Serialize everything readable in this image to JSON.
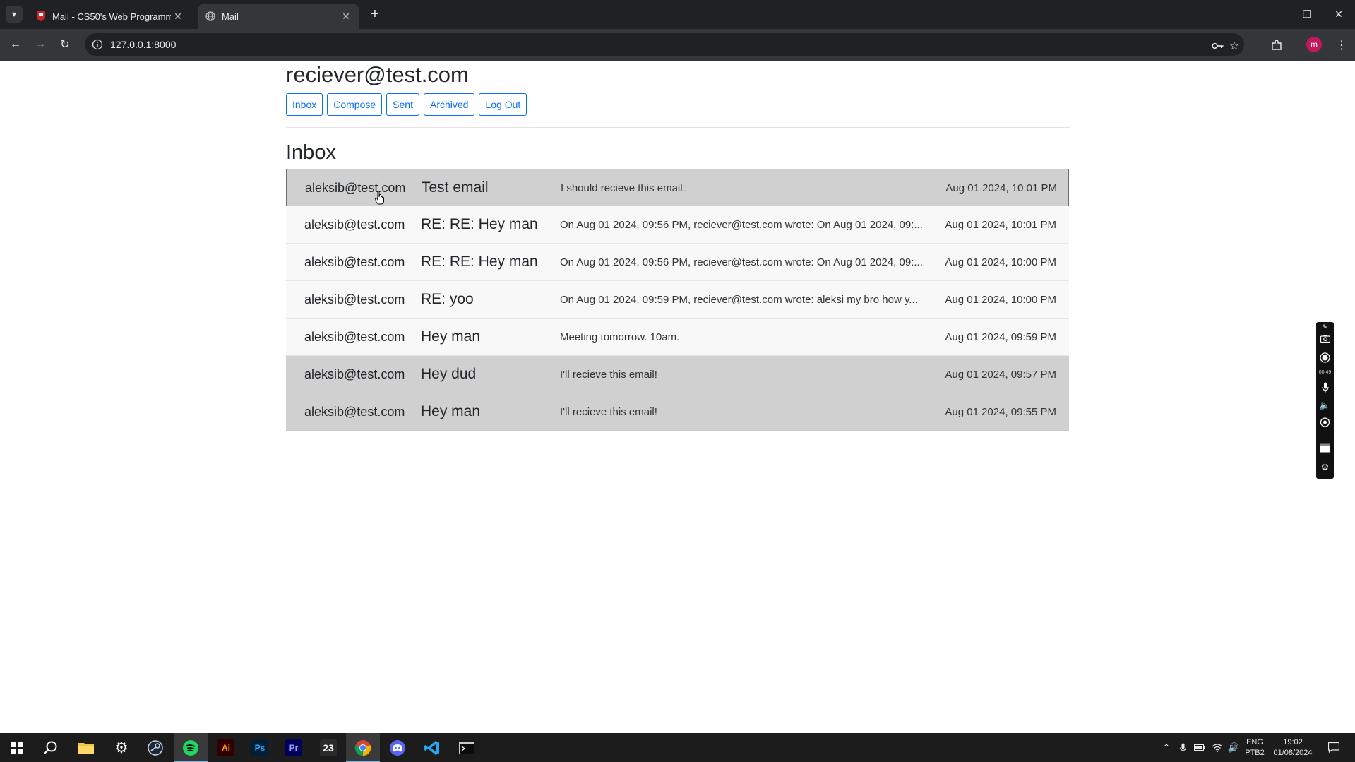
{
  "browser": {
    "tabs": [
      {
        "title": "Mail - CS50's Web Programmin",
        "active": false
      },
      {
        "title": "Mail",
        "active": true
      }
    ],
    "url": "127.0.0.1:8000",
    "profile_initial": "m"
  },
  "page": {
    "user_email": "reciever@test.com",
    "nav_buttons": [
      "Inbox",
      "Compose",
      "Sent",
      "Archived",
      "Log Out"
    ],
    "view_title": "Inbox",
    "emails": [
      {
        "sender": "aleksib@test.com",
        "subject": "Test email",
        "body": "I should recieve this email.",
        "timestamp": "Aug 01 2024, 10:01 PM",
        "read": true
      },
      {
        "sender": "aleksib@test.com",
        "subject": "RE: RE: Hey man",
        "body": "On Aug 01 2024, 09:56 PM, reciever@test.com wrote: On Aug 01 2024, 09:...",
        "timestamp": "Aug 01 2024, 10:01 PM",
        "read": false
      },
      {
        "sender": "aleksib@test.com",
        "subject": "RE: RE: Hey man",
        "body": "On Aug 01 2024, 09:56 PM, reciever@test.com wrote: On Aug 01 2024, 09:...",
        "timestamp": "Aug 01 2024, 10:00 PM",
        "read": false
      },
      {
        "sender": "aleksib@test.com",
        "subject": "RE: yoo",
        "body": "On Aug 01 2024, 09:59 PM, reciever@test.com wrote: aleksi my bro how y...",
        "timestamp": "Aug 01 2024, 10:00 PM",
        "read": false
      },
      {
        "sender": "aleksib@test.com",
        "subject": "Hey man",
        "body": "Meeting tomorrow. 10am.",
        "timestamp": "Aug 01 2024, 09:59 PM",
        "read": false
      },
      {
        "sender": "aleksib@test.com",
        "subject": "Hey dud",
        "body": "I'll recieve this email!",
        "timestamp": "Aug 01 2024, 09:57 PM",
        "read": true
      },
      {
        "sender": "aleksib@test.com",
        "subject": "Hey man",
        "body": "I'll recieve this email!",
        "timestamp": "Aug 01 2024, 09:55 PM",
        "read": true
      }
    ]
  },
  "recorder": {
    "timer": "00:49"
  },
  "taskbar": {
    "apps": [
      "start",
      "search",
      "file-explorer",
      "settings",
      "steam",
      "spotify",
      "illustrator",
      "photoshop",
      "premiere",
      "app-23",
      "chrome",
      "discord",
      "vscode",
      "terminal"
    ],
    "illustrator_label": "Ai",
    "photoshop_label": "Ps",
    "premiere_label": "Pr",
    "app23_label": "23",
    "language": "ENG",
    "keyboard": "PTB2",
    "time": "19:02",
    "date": "01/08/2024"
  },
  "colors": {
    "accent": "#0d6efd",
    "read_row": "#d0d0d0",
    "unread_row": "#f8f8f8",
    "chrome_dark": "#202124",
    "chrome_toolbar": "#35363a"
  }
}
